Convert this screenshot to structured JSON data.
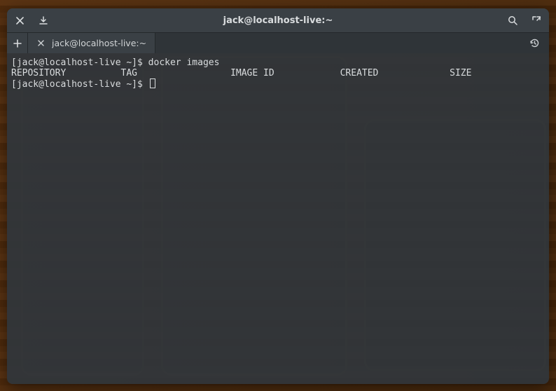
{
  "titlebar": {
    "title": "jack@localhost-live:~"
  },
  "tabs": {
    "items": [
      {
        "label": "jack@localhost-live:~"
      }
    ]
  },
  "command_bar": {
    "placeholder": ""
  },
  "terminal": {
    "prompt": "[jack@localhost-live ~]$ ",
    "lines": [
      {
        "prompt": "[jack@localhost-live ~]$ ",
        "cmd": "docker images"
      },
      {
        "text": "REPOSITORY          TAG                 IMAGE ID            CREATED             SIZE"
      },
      {
        "prompt": "[jack@localhost-live ~]$ ",
        "cmd": "",
        "cursor": true
      }
    ]
  },
  "icons": {
    "close": "close-icon",
    "download": "download-icon",
    "search": "search-icon",
    "fullscreen": "fullscreen-icon",
    "newtab": "plus-icon",
    "history": "history-icon"
  }
}
